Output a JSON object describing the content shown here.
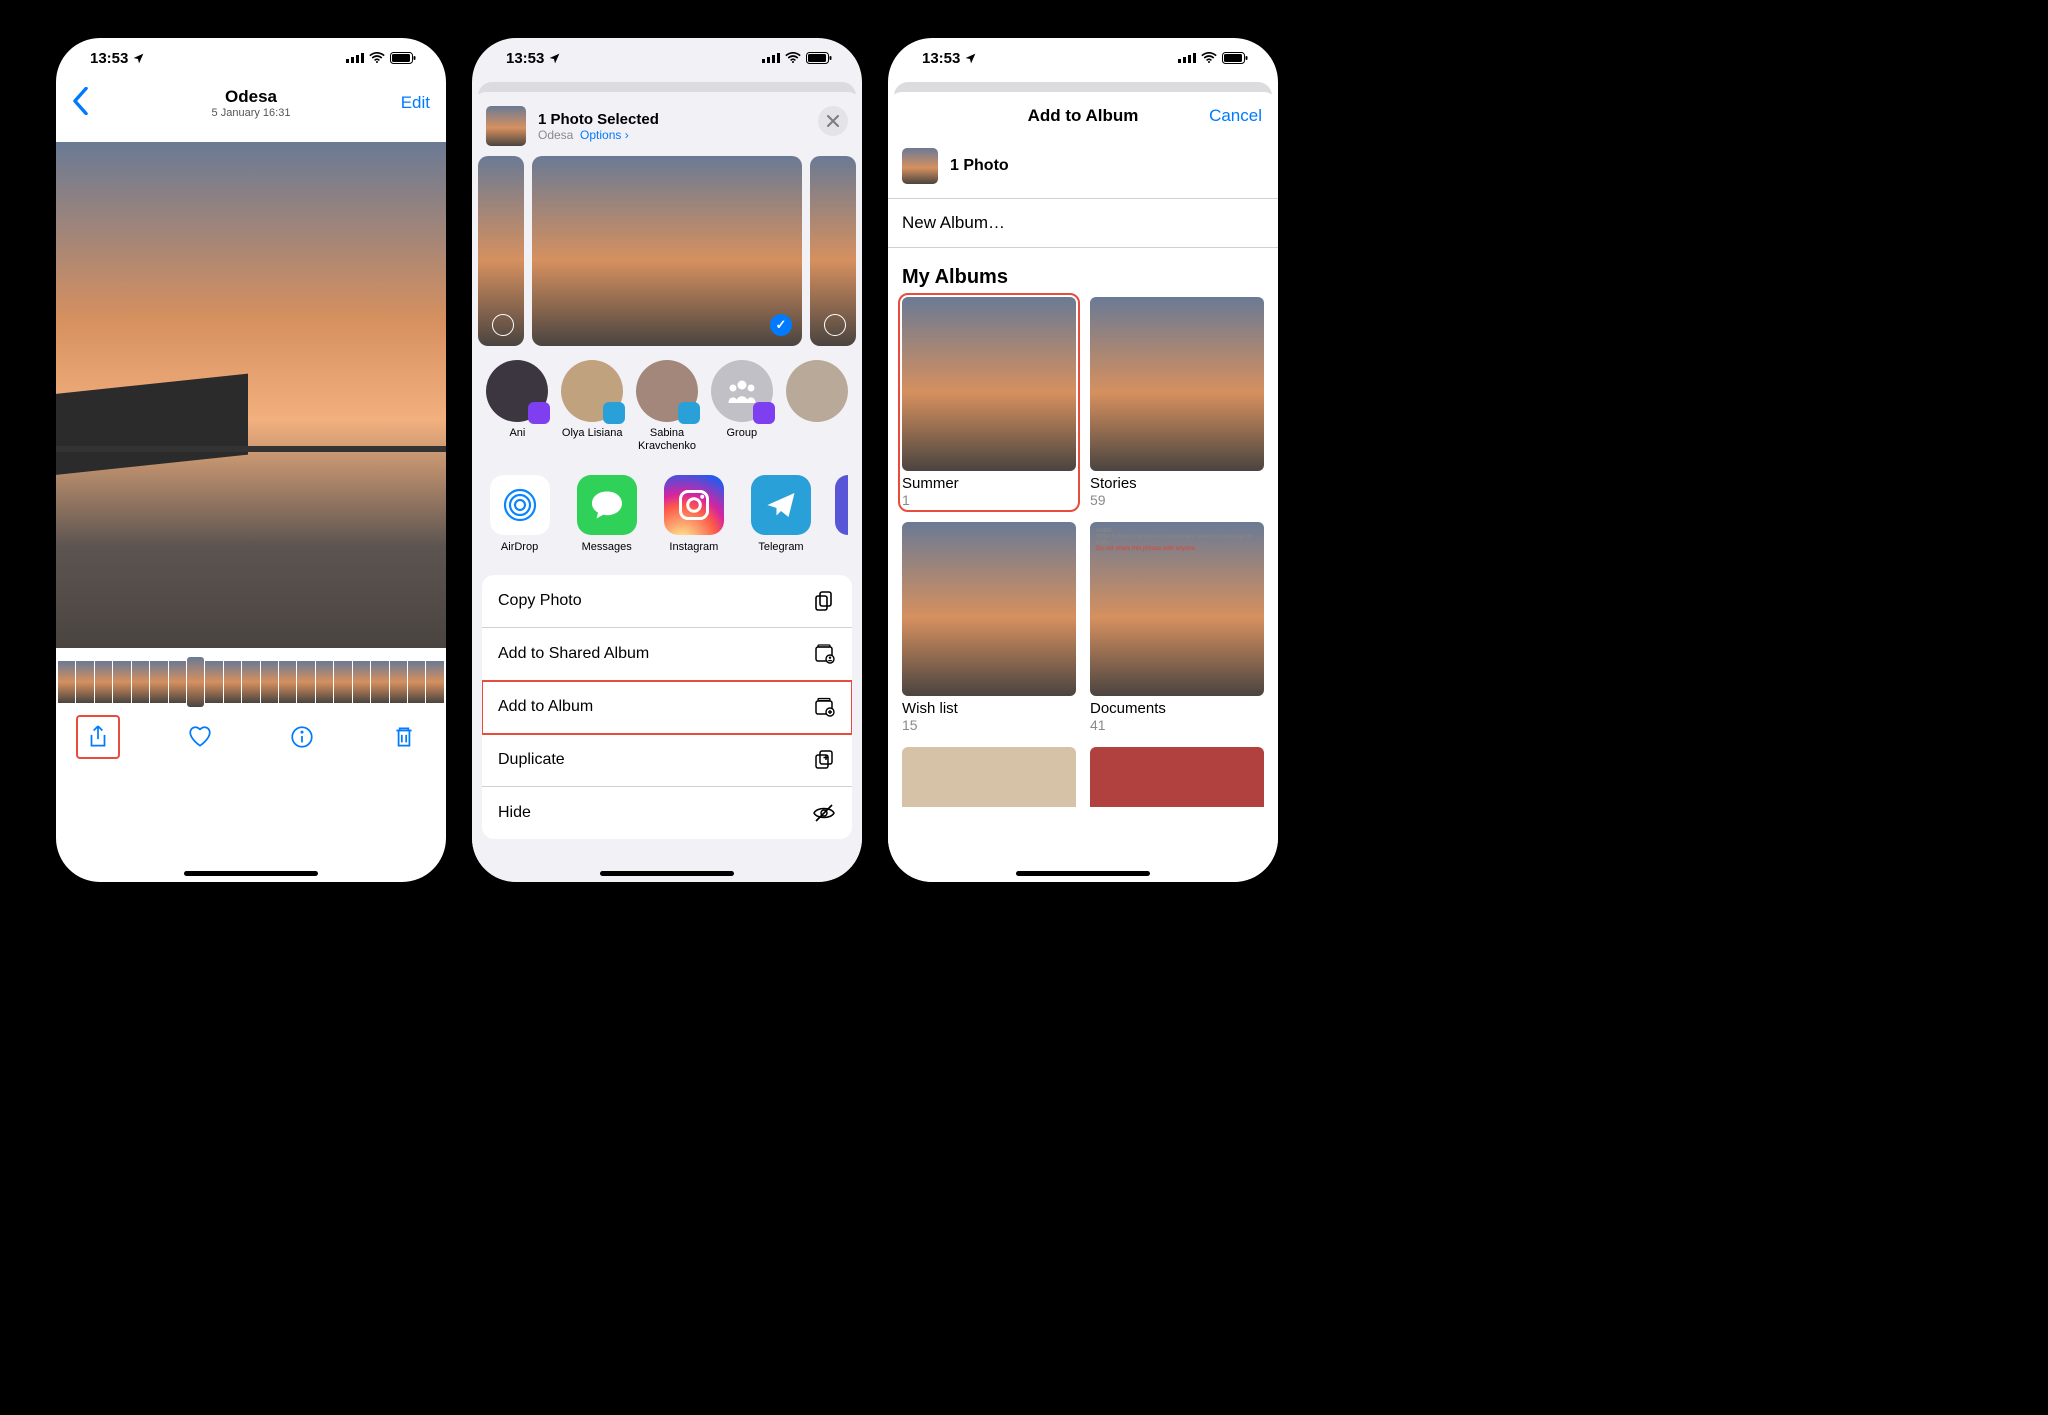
{
  "status_bar": {
    "time": "13:53"
  },
  "screen1": {
    "title": "Odesa",
    "subtitle": "5 January  16:31",
    "edit": "Edit"
  },
  "screen2": {
    "header_title": "1 Photo Selected",
    "header_subtitle_location": "Odesa",
    "header_subtitle_options": "Options",
    "contacts": {
      "c1": "Ani",
      "c2": "Olya Lisiana",
      "c3": "Sabina Kravchenko",
      "c4": "Group"
    },
    "apps": {
      "a1": "AirDrop",
      "a2": "Messages",
      "a3": "Instagram",
      "a4": "Telegram"
    },
    "actions": {
      "copy": "Copy Photo",
      "shared": "Add to Shared Album",
      "album": "Add to Album",
      "dup": "Duplicate",
      "hide": "Hide"
    }
  },
  "screen3": {
    "title": "Add to Album",
    "cancel": "Cancel",
    "selected": "1 Photo",
    "new_album": "New Album…",
    "section": "My Albums",
    "albums": {
      "summer": {
        "name": "Summer",
        "count": "1"
      },
      "stories": {
        "name": "Stories",
        "count": "59"
      },
      "wishlist": {
        "name": "Wish list",
        "count": "15"
      },
      "documents": {
        "name": "Documents",
        "count": "41"
      }
    }
  }
}
